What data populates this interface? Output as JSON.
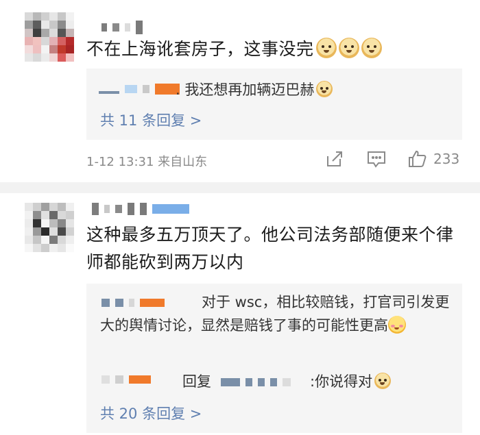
{
  "comments": [
    {
      "text": "不在上海讹套房子，这事没完",
      "replies": [
        {
          "text": ". 我还想再加辆迈巴赫"
        }
      ],
      "more_replies": "共 11 条回复 >",
      "meta": "1-12 13:31  来自山东",
      "like_count": "233"
    },
    {
      "text": "这种最多五万顶天了。他公司法务部随便来个律师都能砍到两万以内",
      "replies": [
        {
          "text": "对于 wsc，相比较赔钱，打官司引发更大的舆情讨论，显然是赔钱了事的可能性更高"
        },
        {
          "prefix": "回复",
          "text": ":你说得对"
        }
      ],
      "more_replies": "共 20 条回复 >"
    }
  ],
  "icons": [
    "dog-emoji",
    "blush-emoji",
    "share-icon",
    "comment-icon",
    "like-icon"
  ],
  "colors": {
    "link": "#5f7fb0",
    "meta": "#8a8a8a",
    "reply_bg": "#f5f5f5",
    "mask_orange": "#f07a2b",
    "mask_blue": "#7aaee8"
  }
}
